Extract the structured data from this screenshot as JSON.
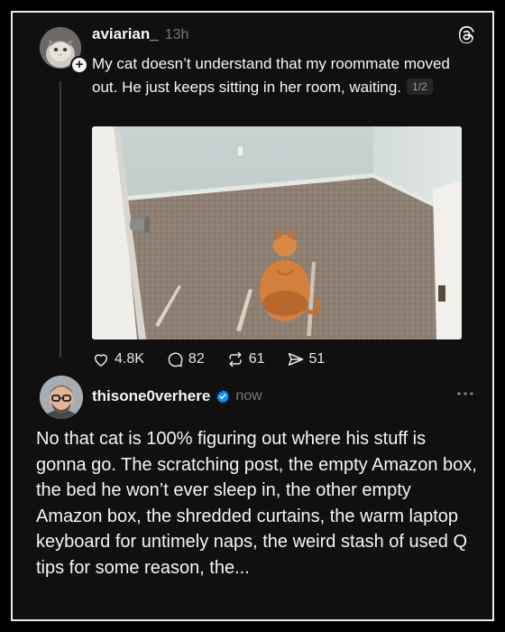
{
  "post": {
    "username": "aviarian_",
    "timestamp": "13h",
    "text": "My cat doesn’t understand that my roommate moved out. He just keeps sitting in her room, waiting.",
    "page_indicator": "1/2",
    "follow_icon": "plus-icon",
    "brand_icon": "threads-logo-icon",
    "image_subject": "orange cat sitting alone in an empty carpeted room",
    "likes": "4.8K",
    "comments": "82",
    "reposts": "61",
    "shares": "51"
  },
  "reply": {
    "username": "thisone0verhere",
    "timestamp": "now",
    "verified_icon": "verified-badge-icon",
    "more_icon": "more-horizontal-icon",
    "text": "No that cat is 100% figuring out where his stuff is gonna go. The scratching post, the empty Amazon box, the bed he won’t ever sleep in, the other empty Amazon box, the shredded curtains, the warm laptop keyboard for untimely naps, the weird stash of used Q tips for some reason, the..."
  },
  "colors": {
    "background": "#101010",
    "text": "#f3f5f7",
    "muted": "#777777",
    "verified": "#0095f6",
    "border": "#e9e9e9"
  }
}
